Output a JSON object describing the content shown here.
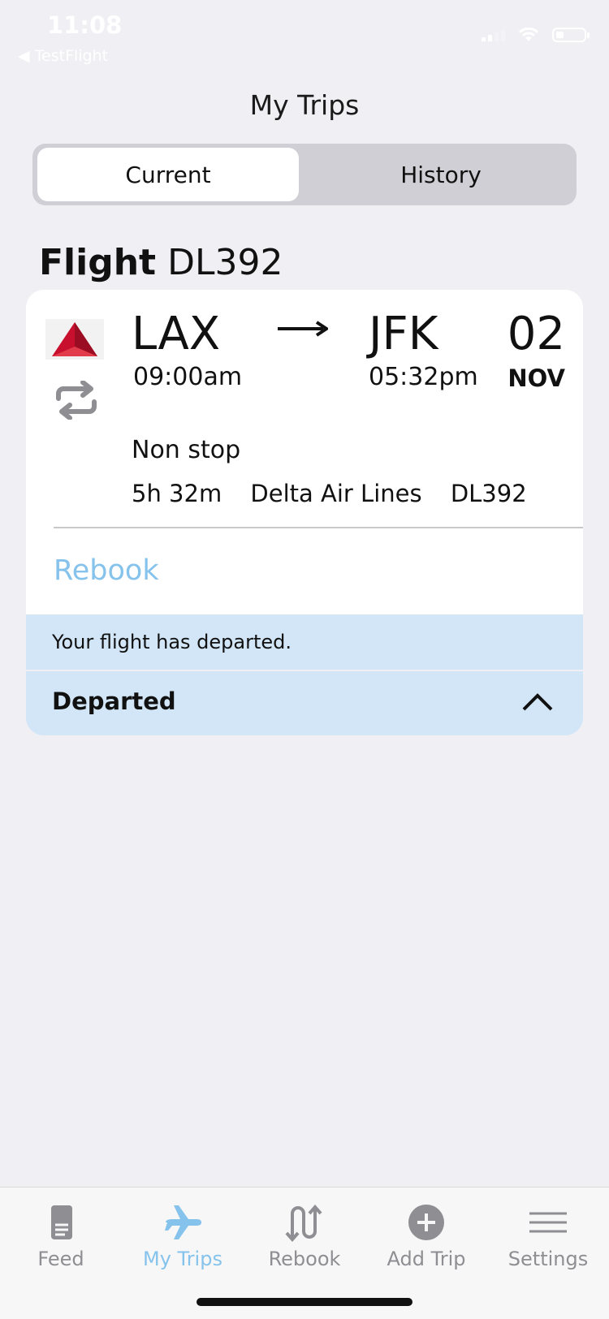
{
  "status_bar": {
    "time": "11:08",
    "back_app": "◀ TestFlight"
  },
  "header": {
    "title": "My Trips"
  },
  "segments": {
    "current": "Current",
    "history": "History"
  },
  "flight_heading": {
    "prefix": "Flight",
    "number": "DL392"
  },
  "flight": {
    "origin_code": "LAX",
    "origin_time": "09:00am",
    "destination_code": "JFK",
    "destination_time": "05:32pm",
    "date_day": "02",
    "date_month": "NOV",
    "stops": "Non stop",
    "duration": "5h 32m",
    "airline": "Delta Air Lines",
    "flight_number": "DL392",
    "rebook_label": "Rebook"
  },
  "notice": {
    "text": "Your flight has departed."
  },
  "status": {
    "label": "Departed"
  },
  "tabs": [
    {
      "label": "Feed",
      "icon": "feed-icon"
    },
    {
      "label": "My Trips",
      "icon": "airplane-icon"
    },
    {
      "label": "Rebook",
      "icon": "rebook-icon"
    },
    {
      "label": "Add Trip",
      "icon": "add-circle-icon"
    },
    {
      "label": "Settings",
      "icon": "menu-icon"
    }
  ],
  "colors": {
    "accent": "#86c3ec",
    "notice_bg": "#d2e6f7",
    "background": "#efeff4",
    "inactive_tab": "#8e8e93"
  }
}
